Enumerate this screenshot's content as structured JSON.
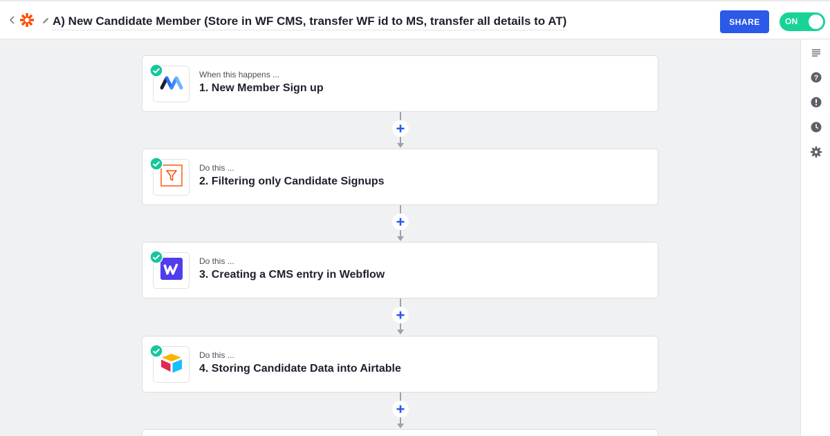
{
  "header": {
    "back_icon": "chevron-left-icon",
    "logo_icon": "zapier-asterisk-icon",
    "edit_icon": "pencil-icon",
    "title": "A) New Candidate Member (Store in WF CMS, transfer WF id to MS, transfer all details to AT)",
    "share_label": "SHARE",
    "toggle_label": "ON",
    "toggle_state": true
  },
  "colors": {
    "brand_blue": "#2b59e8",
    "toggle_green": "#17d397",
    "check_teal": "#16c79a",
    "add_blue": "#2b59e8",
    "zapier_orange": "#ff4a00"
  },
  "steps": [
    {
      "number_title": "1. New Member Sign up",
      "subtitle": "When this happens ...",
      "app_icon": "memberstack-icon",
      "status": "complete"
    },
    {
      "number_title": "2. Filtering only Candidate Signups",
      "subtitle": "Do this ...",
      "app_icon": "filter-icon",
      "status": "complete"
    },
    {
      "number_title": "3. Creating a CMS entry in Webflow",
      "subtitle": "Do this ...",
      "app_icon": "webflow-icon",
      "status": "complete"
    },
    {
      "number_title": "4. Storing Candidate Data into Airtable",
      "subtitle": "Do this ...",
      "app_icon": "airtable-icon",
      "status": "complete"
    }
  ],
  "sidebar": {
    "items": [
      {
        "icon": "list-icon"
      },
      {
        "icon": "help-icon"
      },
      {
        "icon": "alert-icon"
      },
      {
        "icon": "history-clock-icon"
      },
      {
        "icon": "gear-icon"
      }
    ]
  }
}
